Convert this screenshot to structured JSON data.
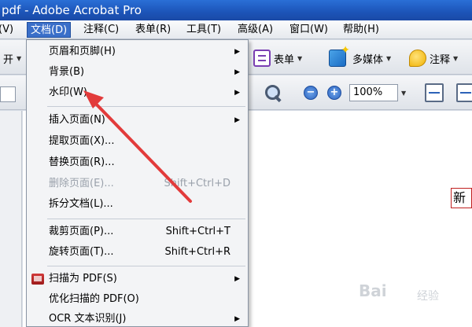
{
  "title_bar": {
    "title": "pdf - Adobe Acrobat Pro"
  },
  "menu_bar": {
    "items": [
      {
        "label": "(V)",
        "active": false
      },
      {
        "label": "文档(D)",
        "active": true
      },
      {
        "label": "注释(C)",
        "active": false
      },
      {
        "label": "表单(R)",
        "active": false
      },
      {
        "label": "工具(T)",
        "active": false
      },
      {
        "label": "高级(A)",
        "active": false
      },
      {
        "label": "窗口(W)",
        "active": false
      },
      {
        "label": "帮助(H)",
        "active": false
      }
    ]
  },
  "toolbar": {
    "left_fragment": "开",
    "forms_label": "表单",
    "multimedia_label": "多媒体",
    "comment_label": "注释",
    "zoom_value": "100%"
  },
  "document_menu": {
    "items": [
      {
        "label": "页眉和页脚(H)",
        "shortcut": "",
        "submenu": true,
        "disabled": false
      },
      {
        "label": "背景(B)",
        "shortcut": "",
        "submenu": true,
        "disabled": false
      },
      {
        "label": "水印(W)",
        "shortcut": "",
        "submenu": true,
        "disabled": false
      },
      {
        "label": "插入页面(N)",
        "shortcut": "",
        "submenu": true,
        "disabled": false
      },
      {
        "label": "提取页面(X)...",
        "shortcut": "",
        "submenu": false,
        "disabled": false
      },
      {
        "label": "替换页面(R)...",
        "shortcut": "",
        "submenu": false,
        "disabled": false
      },
      {
        "label": "删除页面(E)...",
        "shortcut": "Shift+Ctrl+D",
        "submenu": false,
        "disabled": true
      },
      {
        "label": "拆分文档(L)...",
        "shortcut": "",
        "submenu": false,
        "disabled": false
      },
      {
        "label": "裁剪页面(P)...",
        "shortcut": "Shift+Ctrl+T",
        "submenu": false,
        "disabled": false
      },
      {
        "label": "旋转页面(T)...",
        "shortcut": "Shift+Ctrl+R",
        "submenu": false,
        "disabled": false
      },
      {
        "label": "扫描为 PDF(S)",
        "shortcut": "",
        "submenu": true,
        "disabled": false
      },
      {
        "label": "优化扫描的 PDF(O)",
        "shortcut": "",
        "submenu": false,
        "disabled": false
      },
      {
        "label": "OCR 文本识别(J)",
        "shortcut": "",
        "submenu": true,
        "disabled": false
      }
    ]
  },
  "document": {
    "visible_text": "新"
  },
  "watermark": {
    "brand": "Bai",
    "cn": "经验"
  },
  "colors": {
    "accent": "#3a6fc9",
    "arrow": "#e23b3b"
  }
}
